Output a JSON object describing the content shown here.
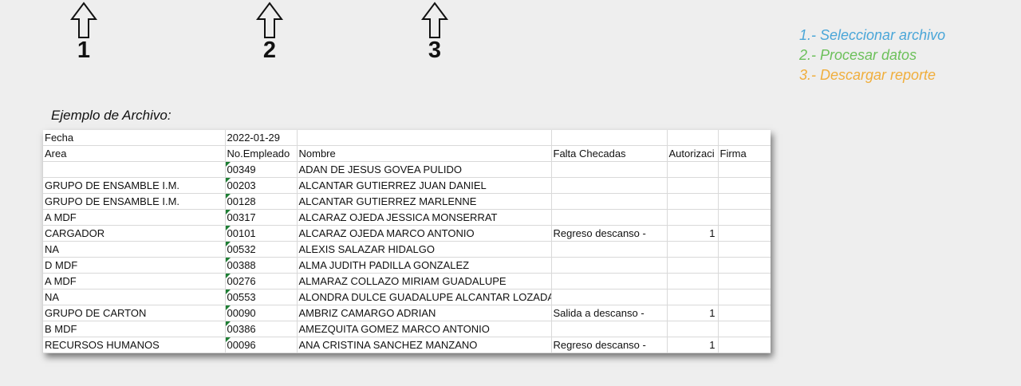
{
  "steps": [
    {
      "number": "1"
    },
    {
      "number": "2"
    },
    {
      "number": "3"
    }
  ],
  "legend": {
    "items": [
      {
        "text": "1.- Seleccionar archivo",
        "color": "#4aa6d8"
      },
      {
        "text": "2.- Procesar datos",
        "color": "#6cc05a"
      },
      {
        "text": "3.- Descargar reporte",
        "color": "#f0ae3c"
      }
    ]
  },
  "caption": "Ejemplo de Archivo:",
  "sheet": {
    "date_row": [
      "Fecha",
      "2022-01-29",
      "",
      "",
      "",
      ""
    ],
    "headers": [
      "Area",
      "No.Empleado",
      "Nombre",
      "Falta Checadas",
      "Autorizaci",
      "Firma"
    ],
    "rows": [
      [
        "",
        "00349",
        "ADAN DE JESUS GOVEA PULIDO",
        "",
        "",
        ""
      ],
      [
        "GRUPO DE ENSAMBLE I.M.",
        "00203",
        "ALCANTAR GUTIERREZ JUAN DANIEL",
        "",
        "",
        ""
      ],
      [
        "GRUPO DE ENSAMBLE I.M.",
        "00128",
        "ALCANTAR GUTIERREZ MARLENNE",
        "",
        "",
        ""
      ],
      [
        "A MDF",
        "00317",
        "ALCARAZ OJEDA JESSICA MONSERRAT",
        "",
        "",
        ""
      ],
      [
        "CARGADOR",
        "00101",
        "ALCARAZ OJEDA MARCO ANTONIO",
        "Regreso descanso -",
        "1",
        ""
      ],
      [
        "NA",
        "00532",
        "ALEXIS SALAZAR HIDALGO",
        "",
        "",
        ""
      ],
      [
        "D MDF",
        "00388",
        "ALMA JUDITH PADILLA GONZALEZ",
        "",
        "",
        ""
      ],
      [
        "A MDF",
        "00276",
        "ALMARAZ COLLAZO MIRIAM GUADALUPE",
        "",
        "",
        ""
      ],
      [
        "NA",
        "00553",
        "ALONDRA DULCE GUADALUPE ALCANTAR LOZADA",
        "",
        "",
        ""
      ],
      [
        "GRUPO DE CARTON",
        "00090",
        "AMBRIZ CAMARGO ADRIAN",
        "Salida a descanso -",
        "1",
        ""
      ],
      [
        "B MDF",
        "00386",
        "AMEZQUITA GOMEZ MARCO ANTONIO",
        "",
        "",
        ""
      ],
      [
        "RECURSOS HUMANOS",
        "00096",
        "ANA CRISTINA SANCHEZ MANZANO",
        "Regreso descanso -",
        "1",
        ""
      ],
      [
        "",
        "",
        "",
        "",
        "",
        ""
      ]
    ]
  }
}
